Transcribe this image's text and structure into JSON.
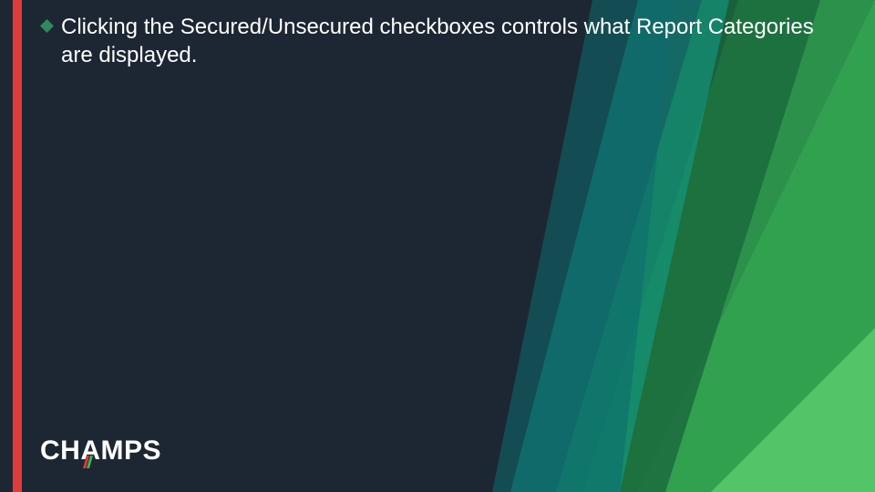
{
  "bullet": {
    "text": "Clicking the Secured/Unsecured checkboxes controls what Report Categories are displayed."
  },
  "logo": {
    "text_left": "CH",
    "text_a": "A",
    "text_right": "MPS"
  },
  "colors": {
    "background": "#1d2733",
    "red": "#e03a3a",
    "teal_dark": "#0c6b6e",
    "teal": "#0fa08e",
    "green_dark": "#1f8a4c",
    "green": "#3fb55a",
    "green_light": "#57c96b",
    "bullet_marker": "#2f8a5b"
  }
}
